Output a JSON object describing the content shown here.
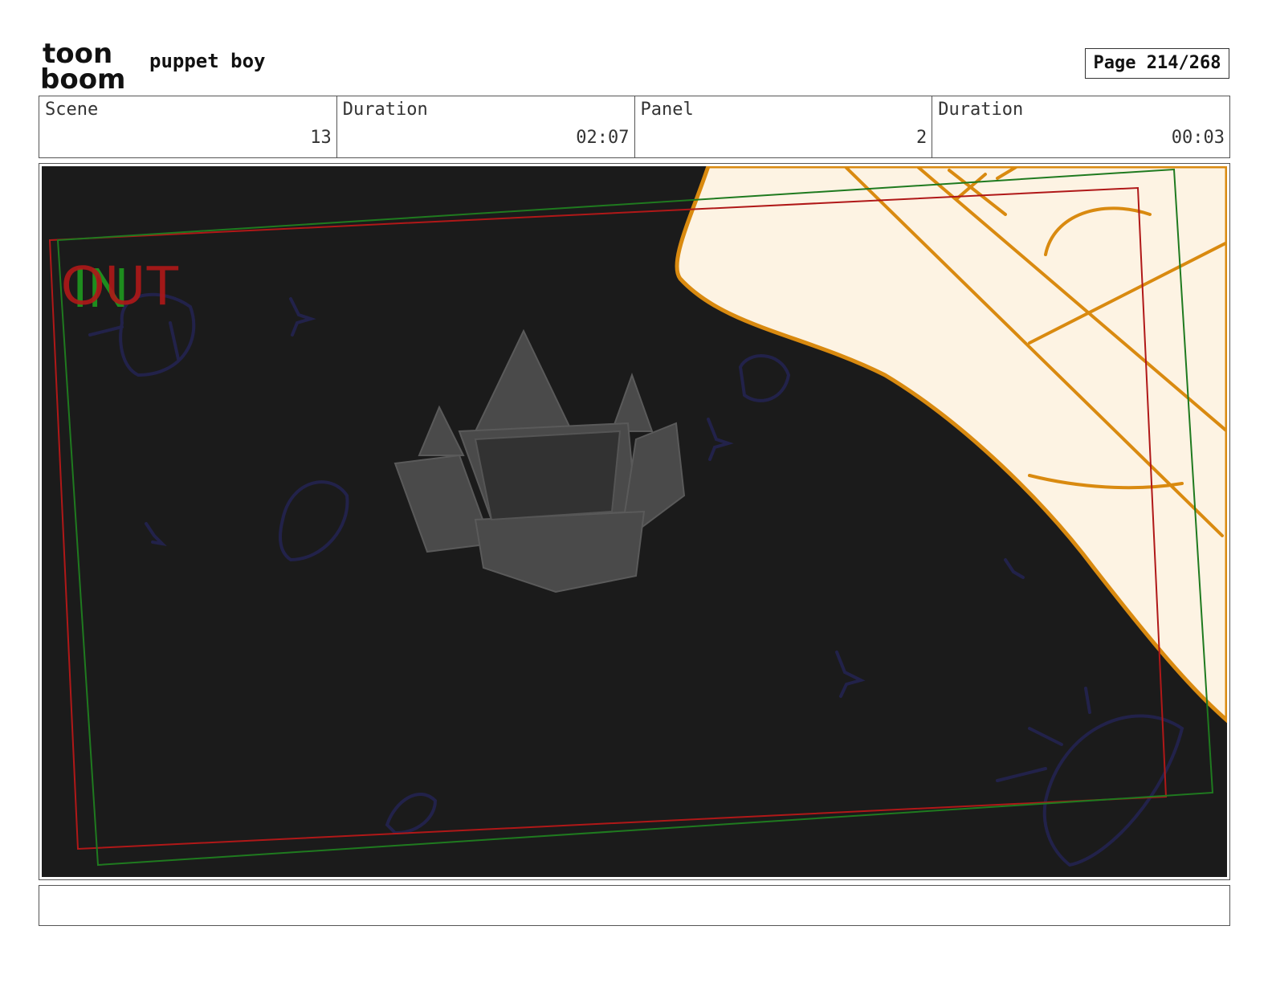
{
  "header": {
    "logo_top": "toon",
    "logo_bottom": "boom",
    "project_title": "puppet boy",
    "page_indicator": "Page 214/268"
  },
  "info": {
    "scene_label": "Scene",
    "scene_value": "13",
    "scene_duration_label": "Duration",
    "scene_duration_value": "02:07",
    "panel_label": "Panel",
    "panel_value": "2",
    "panel_duration_label": "Duration",
    "panel_duration_value": "00:03"
  },
  "panel": {
    "camera_in_label": "IN",
    "camera_out_label": "OUT",
    "colors": {
      "background": "#1b1b1b",
      "sketch_fill": "#fdf3e3",
      "sketch_line": "#d98a10",
      "frame_in": "#1f7a1f",
      "frame_out": "#b01818",
      "doodles": "#22224a",
      "castle": "#4a4a4a"
    }
  },
  "notes": {
    "text": ""
  }
}
